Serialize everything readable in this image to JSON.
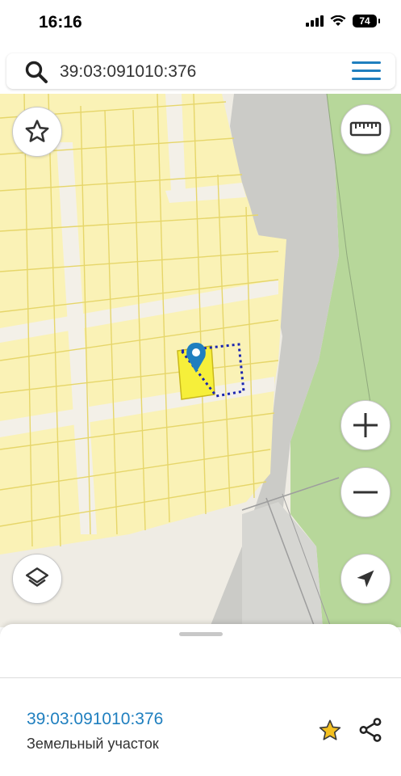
{
  "status_bar": {
    "time": "16:16",
    "battery": "74",
    "icons": [
      "signal-icon",
      "wifi-icon",
      "battery-icon"
    ]
  },
  "search": {
    "value": "39:03:091010:376",
    "icon": "search-icon",
    "menu_icon": "menu-icon"
  },
  "map": {
    "controls": [
      "favorite-star-icon",
      "ruler-icon",
      "zoom-in-icon",
      "zoom-out-icon",
      "layers-icon",
      "location-arrow-icon"
    ],
    "colors": {
      "parcels_fill": "#fbf3b1",
      "parcel_border": "#e8d45a",
      "road": "#f0ede6",
      "selected_parcel": "#f7f240",
      "outline_dots": "#1a25b0",
      "marker": "#1f7fbf",
      "greenzone": "#b8d89a",
      "water_gray": "#cfcfcb"
    }
  },
  "bottom_sheet": {
    "parcel_number": "39:03:091010:376",
    "parcel_type": "Земельный участок",
    "icons": [
      "favorite-star-icon",
      "share-icon"
    ]
  }
}
